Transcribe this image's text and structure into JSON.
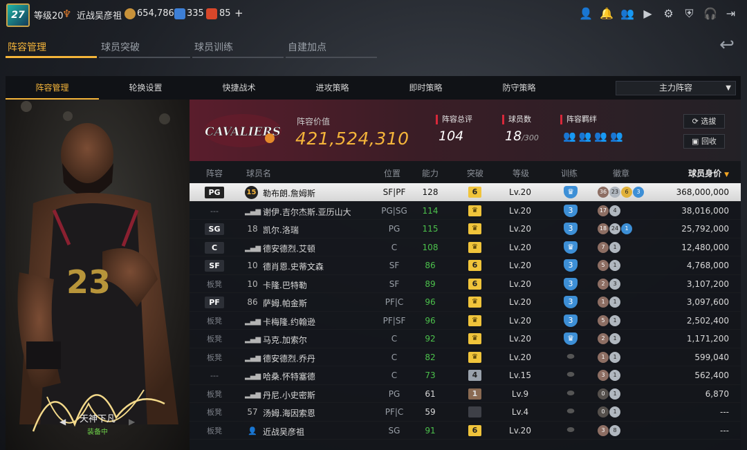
{
  "topbar": {
    "avatar_text": "27",
    "level": "等级20",
    "player_name": "近战吴彦祖",
    "coins": "654,786",
    "stars": "335",
    "tickets": "85",
    "plus": "+",
    "icons": [
      "user-icon",
      "bell-icon",
      "friends-icon",
      "video-icon",
      "gear-icon",
      "shield-icon",
      "headset-icon",
      "exit-icon"
    ]
  },
  "main_tabs": [
    "阵容管理",
    "球员突破",
    "球员训练",
    "自建加点"
  ],
  "sub_tabs": [
    "阵容管理",
    "轮换设置",
    "快捷战术",
    "进攻策略",
    "即时策略",
    "防守策略"
  ],
  "lineup_select": "主力阵容",
  "card": {
    "name": "天神下凡",
    "status": "装备中",
    "jersey": "23"
  },
  "team": {
    "value_label": "阵容价值",
    "value": "421,524,310",
    "rating_label": "阵容总评",
    "rating": "104",
    "count_label": "球员数",
    "count": "18",
    "count_max": "/300",
    "bond_label": "阵容羁绊",
    "select_btn": "选拔",
    "recycle_btn": "回收",
    "logo_text": "CAVALIERS"
  },
  "table": {
    "headers": {
      "lineup": "阵容",
      "name": "球员名",
      "position": "位置",
      "ability": "能力",
      "breakthrough": "突破",
      "level": "等级",
      "training": "训练",
      "badge": "徽章",
      "value": "球员身价"
    },
    "rows": [
      {
        "lineup": "PG",
        "num": "15",
        "name": "勒布朗.詹姆斯",
        "position": "SF|PF",
        "ability": "128",
        "break": "6",
        "level": "Lv.20",
        "value": "368,000,000"
      },
      {
        "lineup": "---",
        "num": "",
        "name": "谢伊.吉尔杰斯.亚历山大",
        "position": "PG|SG",
        "ability": "114",
        "break": "",
        "level": "Lv.20",
        "value": "38,016,000"
      },
      {
        "lineup": "SG",
        "num": "18",
        "name": "凯尔.洛瑞",
        "position": "PG",
        "ability": "115",
        "break": "",
        "level": "Lv.20",
        "value": "25,792,000"
      },
      {
        "lineup": "C",
        "num": "",
        "name": "德安德烈.艾顿",
        "position": "C",
        "ability": "108",
        "break": "",
        "level": "Lv.20",
        "value": "12,480,000"
      },
      {
        "lineup": "SF",
        "num": "10",
        "name": "德肖恩.史蒂文森",
        "position": "SF",
        "ability": "86",
        "break": "6",
        "level": "Lv.20",
        "value": "4,768,000"
      },
      {
        "lineup": "板凳",
        "num": "10",
        "name": "卡隆.巴特勒",
        "position": "SF",
        "ability": "89",
        "break": "6",
        "level": "Lv.20",
        "value": "3,107,200"
      },
      {
        "lineup": "PF",
        "num": "86",
        "name": "萨姆.帕金斯",
        "position": "PF|C",
        "ability": "96",
        "break": "",
        "level": "Lv.20",
        "value": "3,097,600"
      },
      {
        "lineup": "板凳",
        "num": "",
        "name": "卡梅隆.约翰逊",
        "position": "PF|SF",
        "ability": "96",
        "break": "",
        "level": "Lv.20",
        "value": "2,502,400"
      },
      {
        "lineup": "板凳",
        "num": "",
        "name": "马克.加索尔",
        "position": "C",
        "ability": "92",
        "break": "",
        "level": "Lv.20",
        "value": "1,171,200"
      },
      {
        "lineup": "板凳",
        "num": "",
        "name": "德安德烈.乔丹",
        "position": "C",
        "ability": "82",
        "break": "",
        "level": "Lv.20",
        "value": "599,040"
      },
      {
        "lineup": "---",
        "num": "",
        "name": "哈桑.怀特塞德",
        "position": "C",
        "ability": "73",
        "break": "4",
        "level": "Lv.15",
        "value": "562,400"
      },
      {
        "lineup": "板凳",
        "num": "",
        "name": "丹尼.小史密斯",
        "position": "PG",
        "ability": "61",
        "break": "1",
        "level": "Lv.9",
        "value": "6,870"
      },
      {
        "lineup": "板凳",
        "num": "57",
        "name": "汤姆.海因索恩",
        "position": "PF|C",
        "ability": "59",
        "break": "",
        "level": "Lv.4",
        "value": "---"
      },
      {
        "lineup": "板凳",
        "num": "",
        "name": "近战吴彦祖",
        "position": "SG",
        "ability": "91",
        "break": "6",
        "level": "Lv.20",
        "value": "---"
      }
    ],
    "train": [
      "",
      "3",
      "3",
      "",
      "3",
      "3",
      "3",
      "3",
      "",
      "",
      "",
      "",
      "",
      ""
    ],
    "badges": [
      [
        "36",
        "23",
        "6",
        "3"
      ],
      [
        "17",
        "4"
      ],
      [
        "18",
        "24",
        "1"
      ],
      [
        "7",
        "1"
      ],
      [
        "5",
        "1"
      ],
      [
        "2",
        "3"
      ],
      [
        "1",
        "1"
      ],
      [
        "5",
        "1"
      ],
      [
        "2",
        "1"
      ],
      [
        "1",
        "1"
      ],
      [
        "3",
        "1"
      ],
      [
        "0",
        "1"
      ],
      [
        "0",
        "1"
      ],
      [
        "3",
        "8"
      ]
    ]
  },
  "colors": {
    "accent": "#f5b53a",
    "green": "#4cc24c",
    "team_red": "#5a1d2c",
    "train_blue": "#3d8fd6"
  }
}
